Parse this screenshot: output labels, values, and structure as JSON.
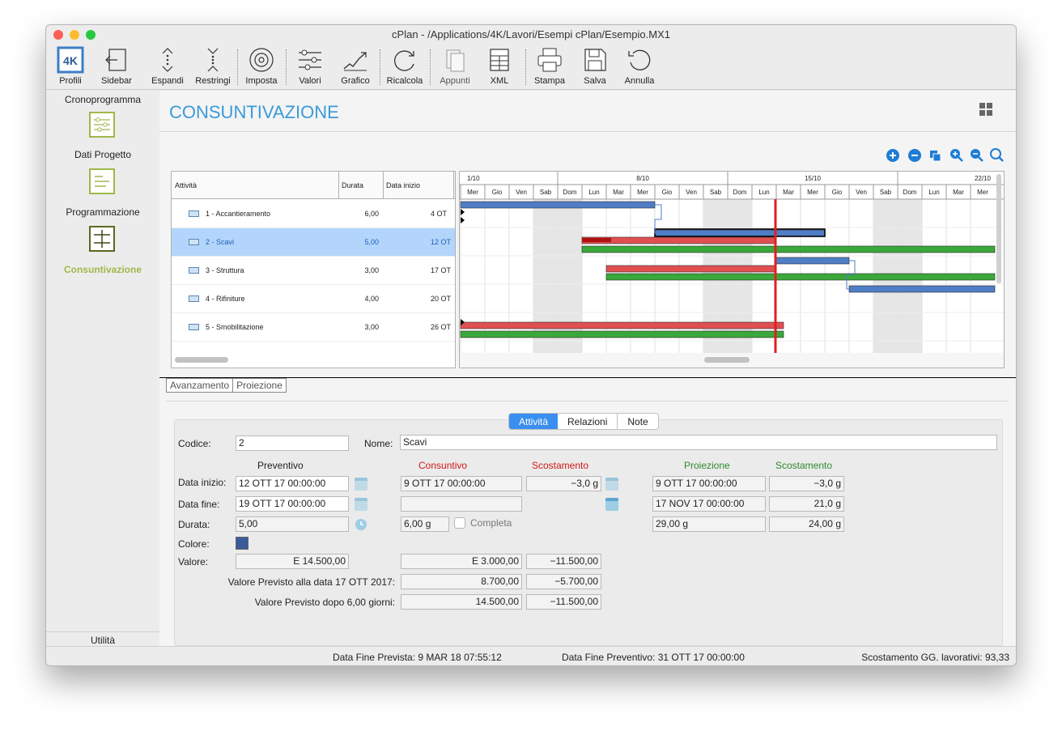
{
  "window": {
    "title": "cPlan - /Applications/4K/Lavori/Esempi cPlan/Esempio.MX1"
  },
  "colors": {
    "accent": "#3a9ad9",
    "sidebar_active": "#9fb84a",
    "actual_red": "#e02020",
    "projection_green": "#3a9a3a",
    "planned_blue": "#4f7ec6",
    "today_line": "#e02020"
  },
  "toolbar": {
    "items": [
      {
        "label": "Profili",
        "icon": "4k-logo-icon"
      },
      {
        "label": "Sidebar",
        "icon": "sidebar-icon"
      },
      {
        "label": "Espandi",
        "icon": "expand-icon"
      },
      {
        "label": "Restringi",
        "icon": "collapse-icon"
      },
      {
        "label": "Imposta",
        "icon": "settings-icon"
      },
      {
        "label": "Valori",
        "icon": "sliders-icon"
      },
      {
        "label": "Grafico",
        "icon": "chart-icon"
      },
      {
        "label": "Ricalcola",
        "icon": "refresh-icon"
      },
      {
        "label": "Appunti",
        "icon": "clipboard-icon"
      },
      {
        "label": "XML",
        "icon": "xml-icon"
      },
      {
        "label": "Stampa",
        "icon": "print-icon"
      },
      {
        "label": "Salva",
        "icon": "save-icon"
      },
      {
        "label": "Annulla",
        "icon": "undo-icon"
      }
    ]
  },
  "sidebar": {
    "section_top": "Cronoprogramma",
    "items": [
      {
        "label": "Dati Progetto",
        "icon": "list-icon"
      },
      {
        "label": "Programmazione",
        "icon": "schedule-icon"
      },
      {
        "label": "Consuntivazione",
        "icon": "report-icon",
        "active": true
      }
    ],
    "section_bottom": "Utilità"
  },
  "page": {
    "title": "CONSUNTIVAZIONE"
  },
  "table": {
    "columns": [
      "Attività",
      "Durata",
      "Data inizio"
    ],
    "rows": [
      {
        "name": "1 - Accantieramento",
        "durata": "6,00",
        "inizio": "4 OT"
      },
      {
        "name": "2 - Scavi",
        "durata": "5,00",
        "inizio": "12 OT",
        "selected": true
      },
      {
        "name": "3 - Struttura",
        "durata": "3,00",
        "inizio": "17 OT"
      },
      {
        "name": "4 - Rifiniture",
        "durata": "4,00",
        "inizio": "20 OT"
      },
      {
        "name": "5 - Smobilitazione",
        "durata": "3,00",
        "inizio": "26 OT"
      }
    ]
  },
  "gantt": {
    "weeks": [
      "1/10",
      "8/10",
      "15/10",
      "22/10"
    ],
    "days": [
      "Mer",
      "Gio",
      "Ven",
      "Sab",
      "Dom",
      "Lun",
      "Mar",
      "Mer",
      "Gio",
      "Ven",
      "Sab",
      "Dom",
      "Lun",
      "Mar",
      "Mer",
      "Gio",
      "Ven",
      "Sab",
      "Dom",
      "Lun",
      "Mar",
      "Mer"
    ]
  },
  "bottom_tabs": [
    "Avanzamento",
    "Proiezione"
  ],
  "detail_tabs": [
    "Attività",
    "Relazioni",
    "Note"
  ],
  "form": {
    "codice_label": "Codice:",
    "codice": "2",
    "nome_label": "Nome:",
    "nome": "Scavi",
    "col_preventivo": "Preventivo",
    "col_consuntivo": "Consuntivo",
    "col_scostamento": "Scostamento",
    "col_proiezione": "Proiezione",
    "col_scostamento2": "Scostamento",
    "data_inizio_label": "Data inizio:",
    "data_inizio_prev": "12 OTT 17 00:00:00",
    "data_inizio_cons": "9 OTT 17 00:00:00",
    "data_inizio_scost": "−3,0 g",
    "data_inizio_proi": "9 OTT 17 00:00:00",
    "data_inizio_scost2": "−3,0 g",
    "data_fine_label": "Data fine:",
    "data_fine_prev": "19 OTT 17 00:00:00",
    "data_fine_cons": "",
    "data_fine_proi": "17 NOV 17 00:00:00",
    "data_fine_scost2": "21,0 g",
    "durata_label": "Durata:",
    "durata_prev": "5,00",
    "durata_cons": "6,00 g",
    "completa_label": "Completa",
    "durata_proi": "29,00 g",
    "durata_scost2": "24,00 g",
    "colore_label": "Colore:",
    "colore": "#3a5a9a",
    "valore_label": "Valore:",
    "valore_prev": "E  14.500,00",
    "valore_cons": "E  3.000,00",
    "valore_scost": "−11.500,00",
    "vp_data_label": "Valore Previsto alla data 17 OTT 2017:",
    "vp_data": "8.700,00",
    "vp_data_scost": "−5.700,00",
    "vp_giorni_label": "Valore Previsto dopo 6,00 giorni:",
    "vp_giorni": "14.500,00",
    "vp_giorni_scost": "−11.500,00"
  },
  "status": {
    "fine_prevista": "Data Fine Prevista: 9 MAR 18 07:55:12",
    "fine_preventivo": "Data Fine Preventivo: 31 OTT 17 00:00:00",
    "scostamento": "Scostamento GG. lavorativi: 93,33"
  }
}
